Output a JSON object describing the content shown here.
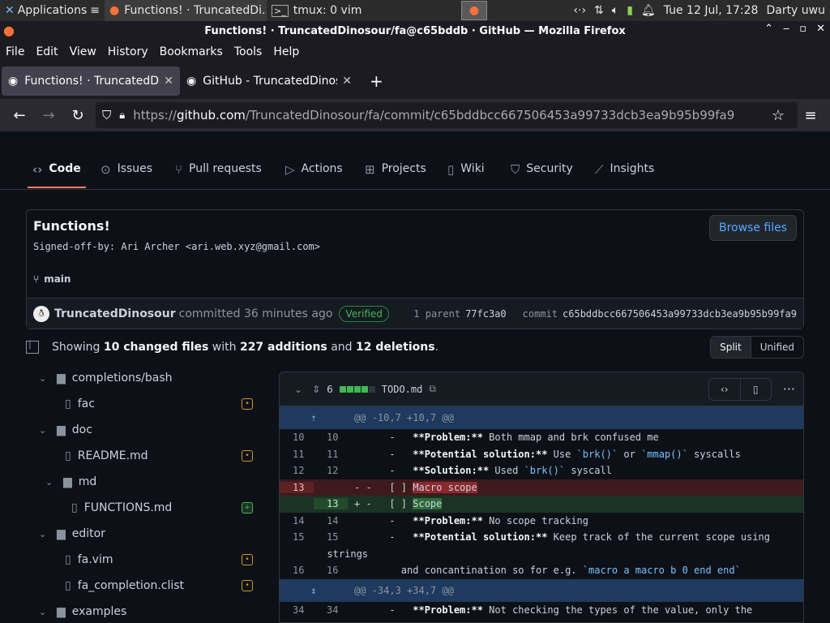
{
  "taskbar": {
    "applications": "Applications",
    "firefox_window": "Functions! · TruncatedDi...",
    "tmux_window": "tmux: 0 vim",
    "clock": "Tue 12 Jul, 17:28",
    "user": "Darty uwu"
  },
  "window": {
    "title": "Functions! · TruncatedDinosour/fa@c65bddb · GitHub — Mozilla Firefox"
  },
  "menu": [
    "File",
    "Edit",
    "View",
    "History",
    "Bookmarks",
    "Tools",
    "Help"
  ],
  "tabs": [
    {
      "label": "Functions! · TruncatedDinosour/fa"
    },
    {
      "label": "GitHub - TruncatedDinosour/fa"
    }
  ],
  "url": {
    "scheme": "https://",
    "host": "github.com",
    "path": "/TruncatedDinosour/fa/commit/c65bddbcc667506453a99733dcb3ea9b95b99fa9"
  },
  "repo_tabs": [
    "Code",
    "Issues",
    "Pull requests",
    "Actions",
    "Projects",
    "Wiki",
    "Security",
    "Insights"
  ],
  "commit": {
    "title": "Functions!",
    "body": "Signed-off-by: Ari Archer <ari.web.xyz@gmail.com>",
    "browse_label": "Browse files",
    "branch": "main",
    "author": "TruncatedDinosour",
    "action": "committed 36 minutes ago",
    "verified": "Verified",
    "parent_label": "1 parent",
    "parent_sha": "77fc3a0",
    "commit_label": "commit",
    "sha": "c65bddbcc667506453a99733dcb3ea9b95b99fa9"
  },
  "summary": {
    "prefix": "Showing ",
    "files": "10 changed files",
    "mid": " with ",
    "additions": "227 additions",
    "and": " and ",
    "deletions": "12 deletions",
    "suffix": ".",
    "split": "Split",
    "unified": "Unified"
  },
  "tree": [
    {
      "name": "completions/bash",
      "type": "folder"
    },
    {
      "name": "fac",
      "type": "file"
    },
    {
      "name": "doc",
      "type": "folder"
    },
    {
      "name": "README.md",
      "type": "file"
    },
    {
      "name": "md",
      "type": "folder"
    },
    {
      "name": "FUNCTIONS.md",
      "type": "file"
    },
    {
      "name": "editor",
      "type": "folder"
    },
    {
      "name": "fa.vim",
      "type": "file"
    },
    {
      "name": "fa_completion.clist",
      "type": "file"
    },
    {
      "name": "examples",
      "type": "folder"
    }
  ],
  "diff": {
    "count": "6",
    "filename": "TODO.md",
    "hunk1": "@@ -10,7 +10,7 @@",
    "hunk2": "@@ -34,3 +34,7 @@",
    "lines": [
      {
        "old": "10",
        "new": "10",
        "text": "      -   **Problem:** Both mmap and brk confused me"
      },
      {
        "old": "11",
        "new": "11",
        "text": "      -   **Potential solution:** Use `brk()` or `mmap()` syscalls"
      },
      {
        "old": "12",
        "new": "12",
        "text": "      -   **Solution:** Used `brk()` syscall"
      },
      {
        "old": "13",
        "new": "",
        "text": "- -   [ ] Macro scope"
      },
      {
        "old": "",
        "new": "13",
        "text": "+ -   [ ] Scope"
      },
      {
        "old": "14",
        "new": "14",
        "text": "      -   **Problem:** No scope tracking"
      },
      {
        "old": "15",
        "new": "15",
        "text": "      -   **Potential solution:** Keep track of the current scope using"
      },
      {
        "old": "",
        "new": "",
        "text": "  strings"
      },
      {
        "old": "16",
        "new": "16",
        "text": "        and concantination so for e.g. `macro a macro b 0 end end`"
      },
      {
        "old": "34",
        "new": "34",
        "text": "      -   **Problem:** Not checking the types of the value, only the"
      }
    ]
  }
}
